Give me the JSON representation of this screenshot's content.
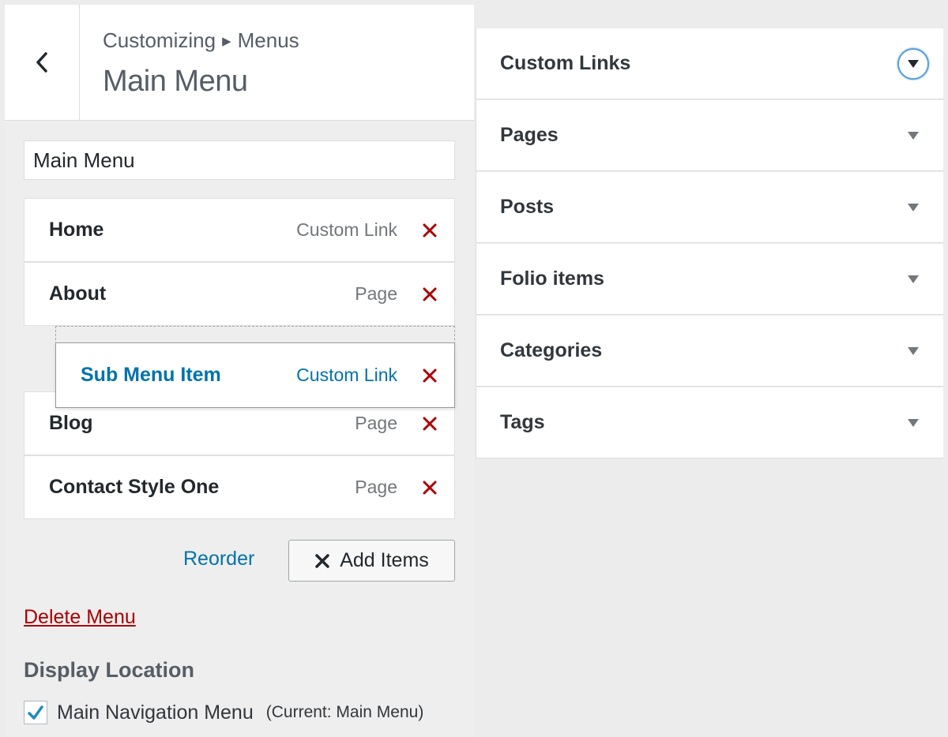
{
  "header": {
    "breadcrumb_parent": "Customizing",
    "breadcrumb_current": "Menus",
    "title": "Main Menu"
  },
  "menu_name": {
    "value": "Main Menu"
  },
  "menu_items": [
    {
      "title": "Home",
      "type": "Custom Link"
    },
    {
      "title": "About",
      "type": "Page"
    },
    {
      "title": "Sub Menu Item",
      "type": "Custom Link",
      "state": "dragging"
    },
    {
      "title": "Blog",
      "type": "Page"
    },
    {
      "title": "Contact Style One",
      "type": "Page"
    }
  ],
  "actions": {
    "reorder_label": "Reorder",
    "add_items_label": "Add Items",
    "delete_label": "Delete Menu"
  },
  "display_location": {
    "heading": "Display Location",
    "label": "Main Navigation Menu",
    "current": "(Current: Main Menu)",
    "checked": true
  },
  "available_sections": [
    {
      "label": "Custom Links",
      "expanded": true
    },
    {
      "label": "Pages",
      "expanded": false
    },
    {
      "label": "Posts",
      "expanded": false
    },
    {
      "label": "Folio items",
      "expanded": false
    },
    {
      "label": "Categories",
      "expanded": false
    },
    {
      "label": "Tags",
      "expanded": false
    }
  ],
  "colors": {
    "link": "#0073aa",
    "remove": "#a00",
    "focus_ring": "#5b9dd9"
  },
  "icons": {
    "back": "chevron-left-icon",
    "breadcrumb_separator": "caret-right-icon",
    "remove": "close-icon",
    "add": "close-icon",
    "checkbox": "checkmark-icon",
    "toggle": "caret-down-icon"
  }
}
